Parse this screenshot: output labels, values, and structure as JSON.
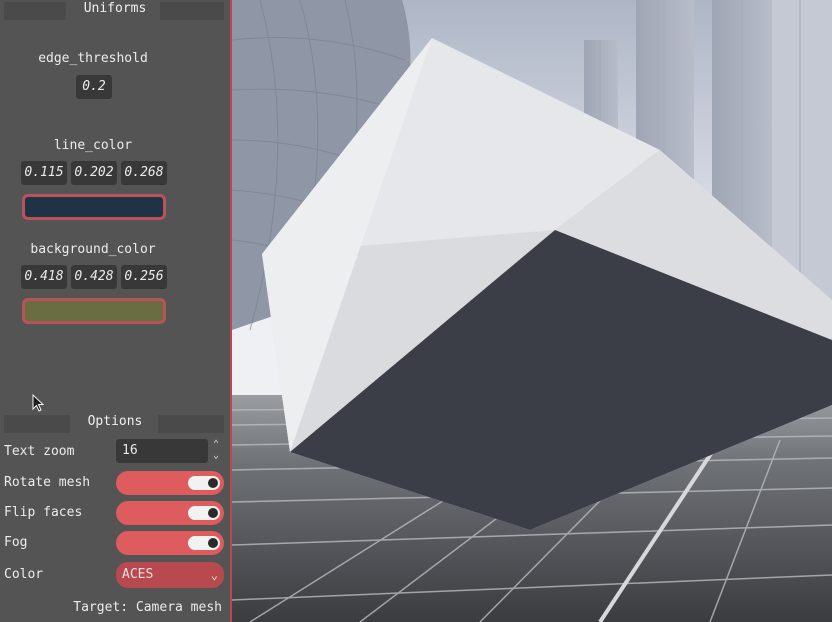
{
  "uniforms": {
    "title": "Uniforms",
    "edge_threshold": {
      "label": "edge_threshold",
      "value": "0.2"
    },
    "line_color": {
      "label": "line_color",
      "values": [
        "0.115",
        "0.202",
        "0.268"
      ],
      "swatch": "#1f3346"
    },
    "background_color": {
      "label": "background_color",
      "values": [
        "0.418",
        "0.428",
        "0.256"
      ],
      "swatch": "#6a6d41"
    }
  },
  "options": {
    "title": "Options",
    "text_zoom": {
      "label": "Text zoom",
      "value": "16"
    },
    "rotate_mesh": {
      "label": "Rotate mesh",
      "on": true
    },
    "flip_faces": {
      "label": "Flip faces",
      "on": true
    },
    "fog": {
      "label": "Fog",
      "on": true
    },
    "color": {
      "label": "Color",
      "value": "ACES"
    },
    "target": "Target: Camera mesh"
  },
  "colors": {
    "accent": "#de5b5e",
    "panel_border": "#b84a4f",
    "cube_light": "#dcdde0",
    "cube_dark": "#3b3e46"
  }
}
